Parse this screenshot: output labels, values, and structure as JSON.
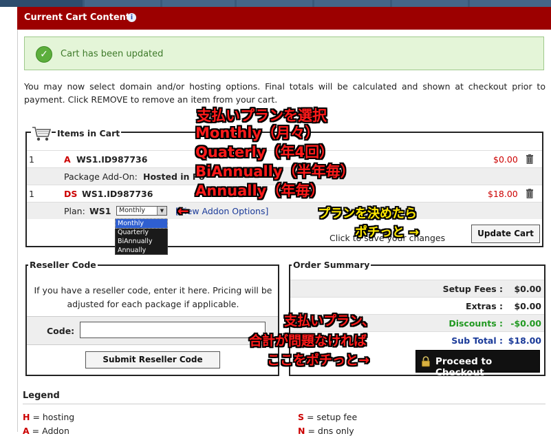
{
  "header": {
    "title": "Current Cart Contents",
    "info_icon": "info-icon"
  },
  "alert": {
    "text": "Cart has been updated",
    "icon": "check-icon"
  },
  "intro_text": "You may now select domain and/or hosting options. Final totals will be calculated and shown at checkout prior to payment. Click REMOVE to remove an item from your cart.",
  "cart": {
    "title": "Items in Cart",
    "items": [
      {
        "qty": "1",
        "type": "A",
        "name": "WS1.ID987736",
        "price": "$0.00"
      },
      {
        "detail_label": "Package Add-On:",
        "detail_value": "Hosted in Po"
      },
      {
        "qty": "1",
        "type": "DS",
        "name": "WS1.ID987736",
        "price": "$18.00"
      }
    ],
    "plan_label": "Plan:",
    "plan_value": "WS1",
    "plan_select": "Monthly",
    "plan_options": [
      "Monthly",
      "Quarterly",
      "BiAnnually",
      "Annually"
    ],
    "addon_link": "[View Addon Options]",
    "click_text": "Click to save your changes",
    "update_button": "Update Cart"
  },
  "reseller": {
    "title": "Reseller Code",
    "description": "If you have a reseller code, enter it here. Pricing will be adjusted for each package if applicable.",
    "code_label": "Code:",
    "code_value": "",
    "submit_button": "Submit Reseller Code"
  },
  "order_summary": {
    "title": "Order Summary",
    "rows": [
      {
        "label": "Setup Fees :",
        "value": "$0.00"
      },
      {
        "label": "Extras :",
        "value": "$0.00"
      },
      {
        "label": "Discounts :",
        "value": "-$0.00"
      },
      {
        "label": "Sub Total :",
        "value": "$18.00"
      }
    ],
    "checkout_button": "Proceed to Checkout"
  },
  "legend": {
    "title": "Legend",
    "items": [
      {
        "key": "H",
        "desc": " = hosting"
      },
      {
        "key": "S",
        "desc": " = setup fee"
      },
      {
        "key": "A",
        "desc": " = Addon"
      },
      {
        "key": "N",
        "desc": " = dns only"
      }
    ]
  },
  "annotations": {
    "plan_lines": [
      "支払いプランを選択",
      "Monthly（月々）",
      "Quaterly（年4回）",
      "BiAnnually（半年毎）",
      "Annually（年毎）"
    ],
    "arrow_left": "←",
    "decide_lines": [
      "プランを決めたら",
      "ポチっと →"
    ],
    "checkout_lines": [
      "支払いプラン、",
      "合計が問題なければ",
      "ここをポチっと→"
    ]
  },
  "colors": {
    "header_bg": "#9c0000",
    "accent_red": "#cc0000",
    "success_green": "#3e7a2a",
    "discount_green": "#229922",
    "subtotal_blue": "#1a3a99"
  }
}
